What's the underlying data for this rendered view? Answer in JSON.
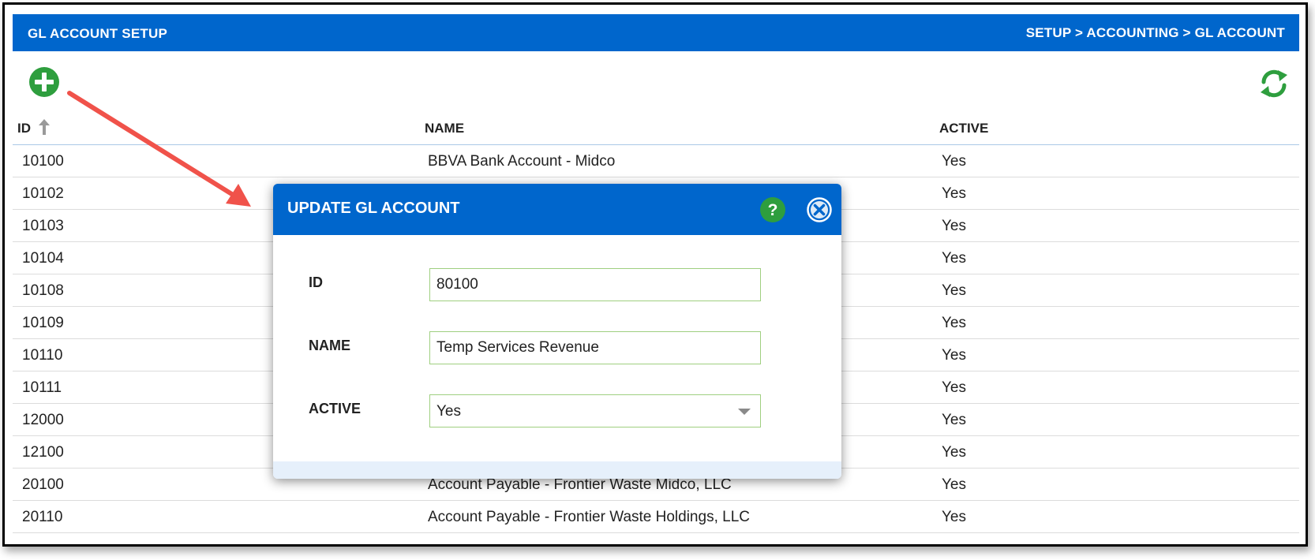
{
  "header": {
    "title": "GL ACCOUNT SETUP",
    "breadcrumb": "SETUP > ACCOUNTING > GL ACCOUNT"
  },
  "toolbar": {
    "add_icon": "plus-circle-icon",
    "refresh_icon": "refresh-icon"
  },
  "table": {
    "columns": [
      "ID",
      "NAME",
      "ACTIVE"
    ],
    "sort": {
      "column": "ID",
      "direction": "ascending"
    },
    "rows": [
      {
        "id": "10100",
        "name": "BBVA Bank Account - Midco",
        "active": "Yes"
      },
      {
        "id": "10102",
        "name": "",
        "active": "Yes"
      },
      {
        "id": "10103",
        "name": "",
        "active": "Yes"
      },
      {
        "id": "10104",
        "name": "",
        "active": "Yes"
      },
      {
        "id": "10108",
        "name": "",
        "active": "Yes"
      },
      {
        "id": "10109",
        "name": "",
        "active": "Yes"
      },
      {
        "id": "10110",
        "name": "",
        "active": "Yes"
      },
      {
        "id": "10111",
        "name": "",
        "active": "Yes"
      },
      {
        "id": "12000",
        "name": "",
        "active": "Yes"
      },
      {
        "id": "12100",
        "name": "",
        "active": "Yes"
      },
      {
        "id": "20100",
        "name": "Account Payable - Frontier Waste Midco, LLC",
        "active": "Yes"
      },
      {
        "id": "20110",
        "name": "Account Payable - Frontier Waste Holdings, LLC",
        "active": "Yes"
      }
    ]
  },
  "modal": {
    "title": "UPDATE GL ACCOUNT",
    "help_icon": "help-icon",
    "close_icon": "close-icon",
    "fields": {
      "id_label": "ID",
      "id_value": "80100",
      "name_label": "NAME",
      "name_value": "Temp Services Revenue",
      "active_label": "ACTIVE",
      "active_value": "Yes"
    }
  },
  "colors": {
    "header_blue": "#0066cc",
    "add_green": "#2e9e3e",
    "annotation_red": "#f0524a",
    "input_border": "#9fcf80"
  }
}
